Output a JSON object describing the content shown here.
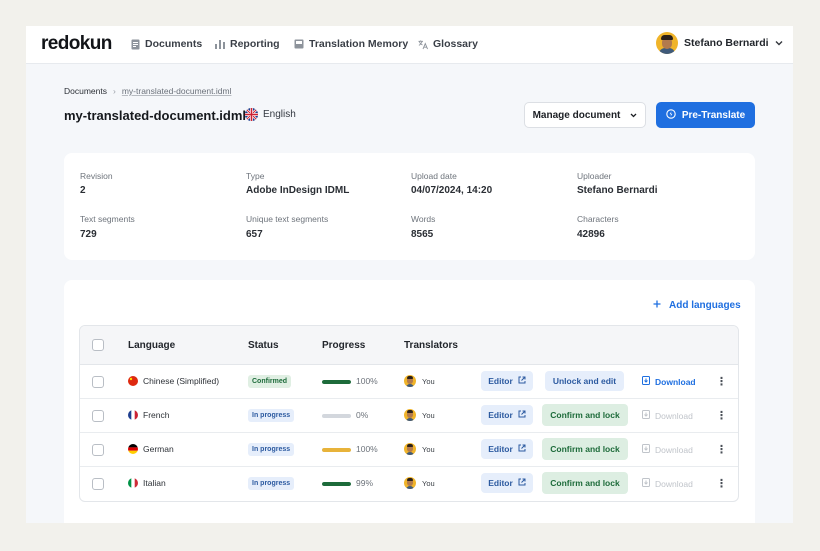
{
  "app": {
    "logo": "redokun"
  },
  "nav": [
    {
      "label": "Documents",
      "icon": "document-icon"
    },
    {
      "label": "Reporting",
      "icon": "bar-chart-icon"
    },
    {
      "label": "Translation Memory",
      "icon": "memory-icon"
    },
    {
      "label": "Glossary",
      "icon": "translate-icon"
    }
  ],
  "user": {
    "name": "Stefano Bernardi"
  },
  "breadcrumb": {
    "root": "Documents",
    "separator": "›",
    "current": "my-translated-document.idml"
  },
  "document": {
    "title": "my-translated-document.idml",
    "source_language": "English"
  },
  "actions": {
    "manage": "Manage document",
    "pretranslate": "Pre-Translate"
  },
  "meta": [
    {
      "label": "Revision",
      "value": "2"
    },
    {
      "label": "Type",
      "value": "Adobe InDesign IDML"
    },
    {
      "label": "Upload date",
      "value": "04/07/2024, 14:20"
    },
    {
      "label": "Uploader",
      "value": "Stefano Bernardi"
    },
    {
      "label": "Text segments",
      "value": "729"
    },
    {
      "label": "Unique text segments",
      "value": "657"
    },
    {
      "label": "Words",
      "value": "8565"
    },
    {
      "label": "Characters",
      "value": "42896"
    }
  ],
  "languages_section": {
    "add_label": "Add languages",
    "columns": {
      "language": "Language",
      "status": "Status",
      "progress": "Progress",
      "translators": "Translators"
    },
    "rows": [
      {
        "language": "Chinese (Simplified)",
        "flag": "cn",
        "status": "Confirmed",
        "status_type": "confirmed",
        "progress": 1.0,
        "progress_label": "100%",
        "progress_color": "#1d6b3a",
        "translator": "You",
        "editor": "Editor",
        "action": "Unlock and edit",
        "action_type": "unlock",
        "download": "Download",
        "download_enabled": true
      },
      {
        "language": "French",
        "flag": "fr",
        "status": "In progress",
        "status_type": "progress",
        "progress": 0.0,
        "progress_label": "0%",
        "progress_color": "#d3d7dd",
        "translator": "You",
        "editor": "Editor",
        "action": "Confirm and lock",
        "action_type": "confirm",
        "download": "Download",
        "download_enabled": false
      },
      {
        "language": "German",
        "flag": "de",
        "status": "In progress",
        "status_type": "progress",
        "progress": 1.0,
        "progress_label": "100%",
        "progress_color": "#e8b33a",
        "translator": "You",
        "editor": "Editor",
        "action": "Confirm and lock",
        "action_type": "confirm",
        "download": "Download",
        "download_enabled": false
      },
      {
        "language": "Italian",
        "flag": "it",
        "status": "In progress",
        "status_type": "progress",
        "progress": 0.99,
        "progress_label": "99%",
        "progress_color": "#1d6b3a",
        "translator": "You",
        "editor": "Editor",
        "action": "Confirm and lock",
        "action_type": "confirm",
        "download": "Download",
        "download_enabled": false
      }
    ]
  }
}
